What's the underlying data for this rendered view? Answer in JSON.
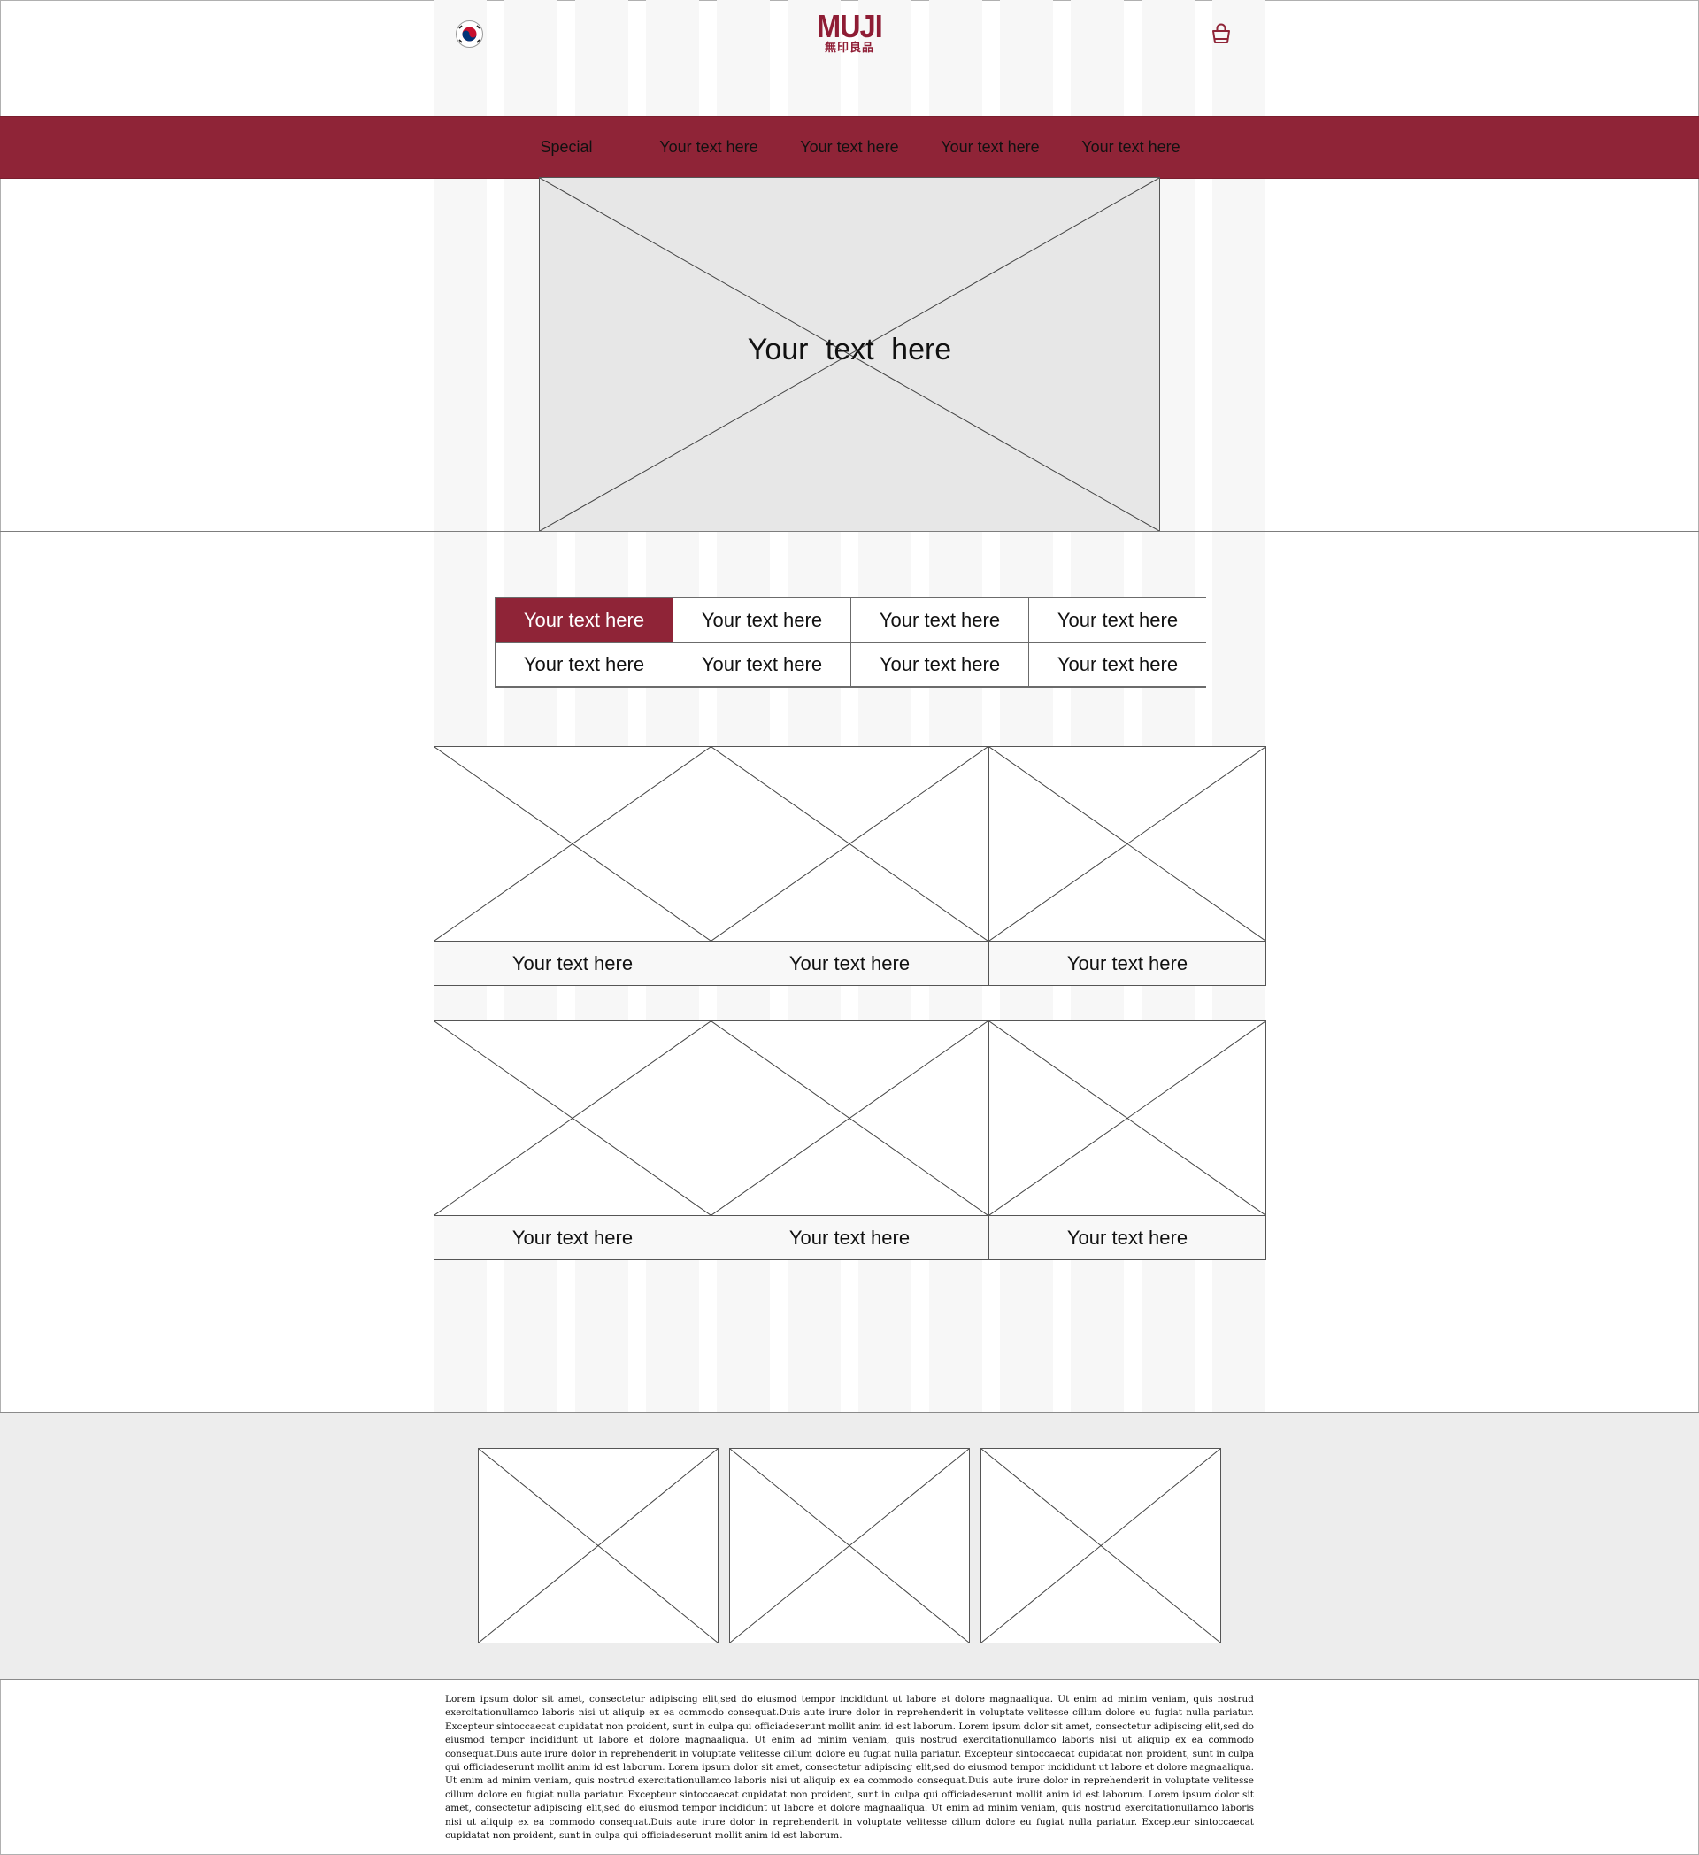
{
  "header": {
    "flag_icon": "korea-flag-icon",
    "logo_text": "MUJI",
    "logo_subtext": "無印良品",
    "cart_icon": "shopping-bag-icon",
    "brand_color": "#8f2437"
  },
  "nav": {
    "items": [
      "Special",
      "Your text here",
      "Your text here",
      "Your text here",
      "Your text here"
    ]
  },
  "hero": {
    "text": "Your  text  here"
  },
  "tabs": {
    "items": [
      "Your text here",
      "Your text here",
      "Your text here",
      "Your text here",
      "Your text here",
      "Your text here",
      "Your text here",
      "Your text here"
    ]
  },
  "products": {
    "row1": [
      "Your text here",
      "Your text here",
      "Your text here"
    ],
    "row2": [
      "Your text here",
      "Your text here",
      "Your text here"
    ]
  },
  "footer": {
    "text": "Lorem ipsum dolor sit amet, consectetur adipiscing elit,sed do eiusmod tempor incididunt ut labore et dolore magnaaliqua. Ut enim ad minim veniam, quis nostrud exercitationullamco laboris nisi ut aliquip ex ea commodo consequat.Duis aute irure dolor in reprehenderit in voluptate velitesse cillum dolore eu fugiat nulla pariatur. Excepteur sintoccaecat cupidatat non proident, sunt in culpa qui officiadeserunt mollit anim id est laborum.  Lorem ipsum dolor sit amet, consectetur adipiscing elit,sed do eiusmod tempor incididunt ut labore et dolore magnaaliqua. Ut enim ad minim veniam, quis nostrud exercitationullamco laboris nisi ut aliquip ex ea commodo consequat.Duis aute irure dolor in reprehenderit in voluptate velitesse cillum dolore eu fugiat nulla pariatur. Excepteur sintoccaecat cupidatat non proident, sunt in culpa qui officiadeserunt mollit anim id est laborum.  Lorem ipsum dolor sit amet, consectetur adipiscing elit,sed do eiusmod tempor incididunt ut labore et dolore magnaaliqua. Ut enim ad minim veniam, quis nostrud exercitationullamco laboris nisi ut aliquip ex ea commodo consequat.Duis aute irure dolor in reprehenderit in voluptate velitesse cillum dolore eu fugiat nulla pariatur. Excepteur sintoccaecat cupidatat non proident, sunt in culpa qui officiadeserunt mollit anim id est laborum.  Lorem ipsum dolor sit amet, consectetur adipiscing elit,sed do eiusmod tempor incididunt ut labore et dolore magnaaliqua. Ut enim ad minim veniam, quis nostrud exercitationullamco laboris nisi ut aliquip ex ea commodo consequat.Duis aute irure dolor in reprehenderit in voluptate velitesse cillum dolore eu fugiat nulla pariatur. Excepteur sintoccaecat cupidatat non proident, sunt in culpa qui officiadeserunt mollit anim id est laborum."
  }
}
